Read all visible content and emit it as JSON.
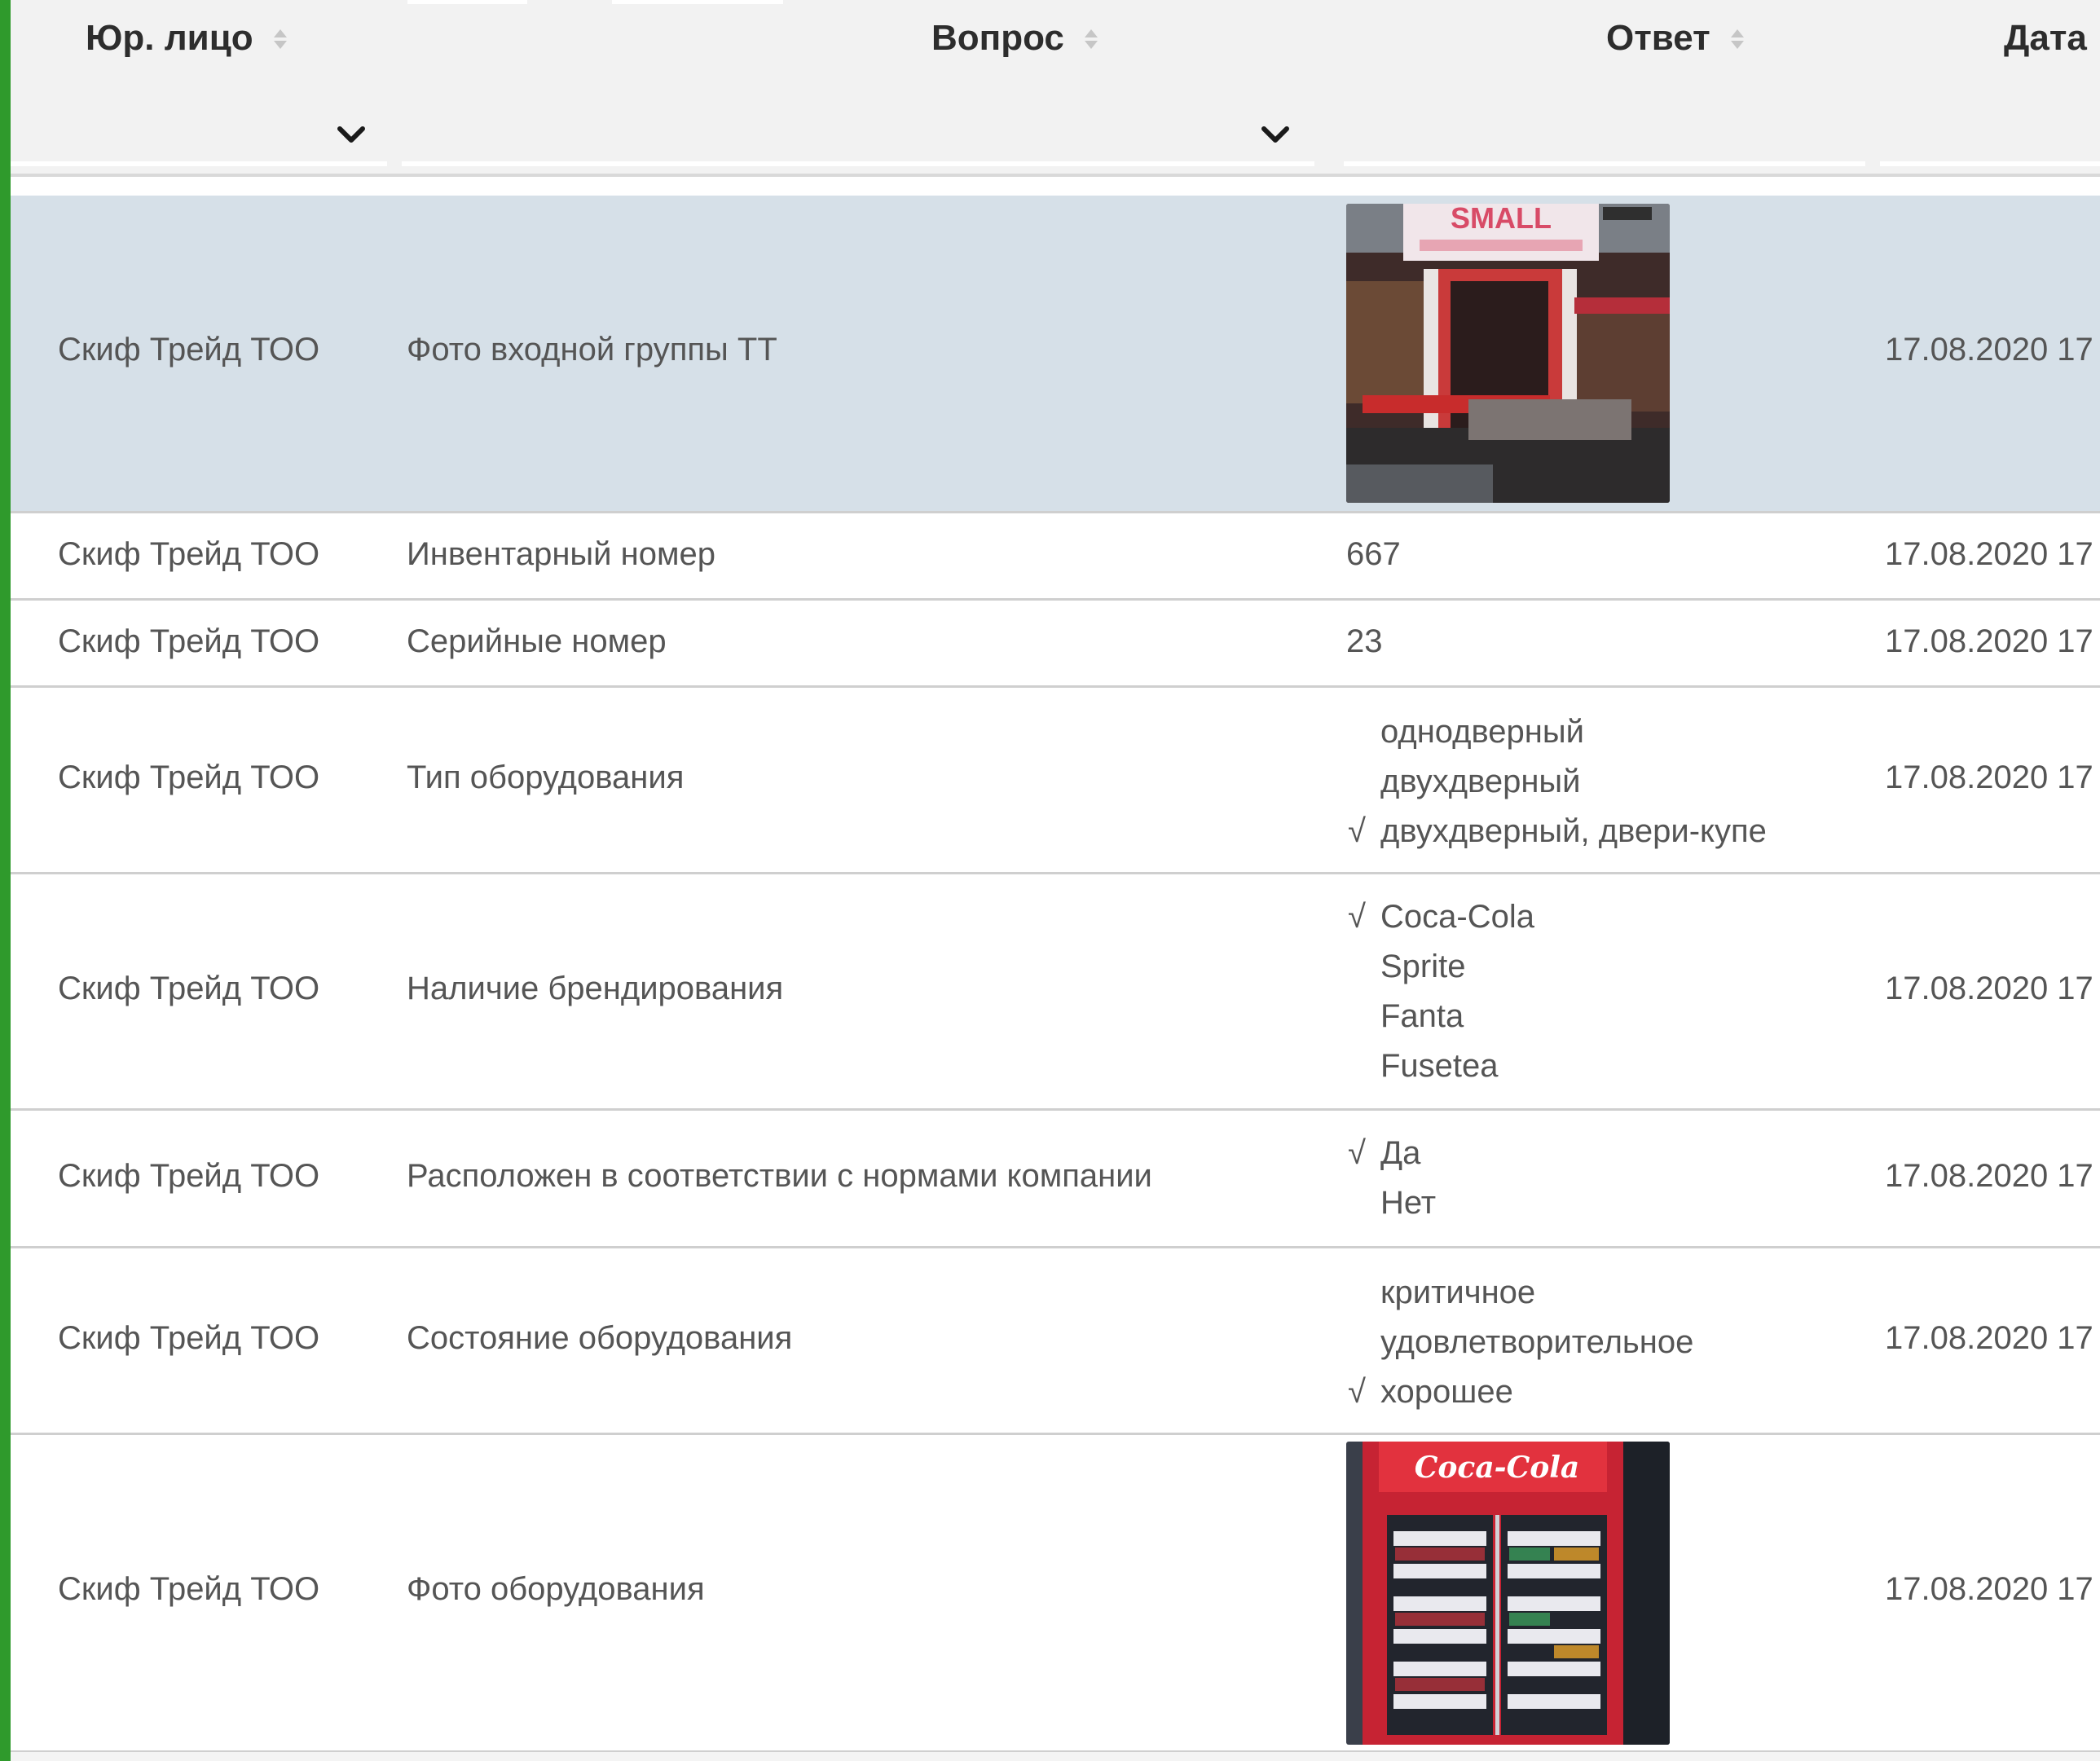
{
  "table": {
    "columns": {
      "entity": "Юр. лицо",
      "question": "Вопрос",
      "answer": "Ответ",
      "date": "Дата"
    },
    "rows": [
      {
        "entity": "Скиф Трейд ТОО",
        "question": "Фото входной группы ТТ",
        "answer_type": "photo",
        "photo_sign": "SMALL",
        "date": "17.08.2020 17"
      },
      {
        "entity": "Скиф Трейд ТОО",
        "question": "Инвентарный номер",
        "answer_type": "text",
        "answer": "667",
        "date": "17.08.2020 17"
      },
      {
        "entity": "Скиф Трейд ТОО",
        "question": "Серийные номер",
        "answer_type": "text",
        "answer": "23",
        "date": "17.08.2020 17"
      },
      {
        "entity": "Скиф Трейд ТОО",
        "question": "Тип оборудования",
        "answer_type": "options",
        "options": [
          {
            "label": "однодверный",
            "checked": false
          },
          {
            "label": "двухдверный",
            "checked": false
          },
          {
            "label": "двухдверный, двери-купе",
            "checked": true
          }
        ],
        "date": "17.08.2020 17"
      },
      {
        "entity": "Скиф Трейд ТОО",
        "question": "Наличие брендирования",
        "answer_type": "options",
        "options": [
          {
            "label": "Coca-Cola",
            "checked": true
          },
          {
            "label": "Sprite",
            "checked": false
          },
          {
            "label": "Fanta",
            "checked": false
          },
          {
            "label": "Fusetea",
            "checked": false
          }
        ],
        "date": "17.08.2020 17"
      },
      {
        "entity": "Скиф Трейд ТОО",
        "question": "Расположен в соответствии с нормами компании",
        "answer_type": "options",
        "options": [
          {
            "label": "Да",
            "checked": true
          },
          {
            "label": "Нет",
            "checked": false
          }
        ],
        "date": "17.08.2020 17"
      },
      {
        "entity": "Скиф Трейд ТОО",
        "question": "Состояние оборудования",
        "answer_type": "options",
        "options": [
          {
            "label": "критичное",
            "checked": false
          },
          {
            "label": "удовлетворительное",
            "checked": false
          },
          {
            "label": "хорошее",
            "checked": true
          }
        ],
        "date": "17.08.2020 17"
      },
      {
        "entity": "Скиф Трейд ТОО",
        "question": "Фото оборудования",
        "answer_type": "photo",
        "photo_sign": "Coca-Cola",
        "date": "17.08.2020 17"
      }
    ]
  },
  "check_glyph": "√",
  "colors": {
    "accent_bar": "#2f9a2c",
    "selected_row": "#d6e0e8",
    "header_bg": "#f2f2f2"
  }
}
